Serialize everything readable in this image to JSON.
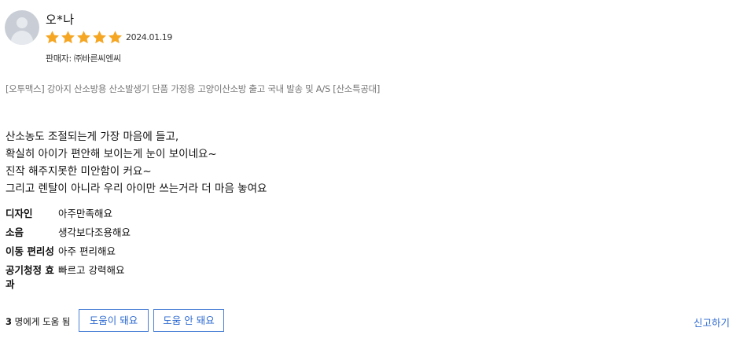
{
  "review": {
    "author": "오*나",
    "rating": 5,
    "rating_max": 5,
    "star_color": "#f5a623",
    "date": "2024.01.19",
    "seller": "판매자: ㈜바른씨엔씨",
    "product": "[오투맥스] 강아지 산소방용 산소발생기 단품 가정용 고양이산소방 출고 국내 발송 및 A/S [산소특공대]",
    "content_lines": [
      "산소농도 조절되는게 가장 마음에 들고,",
      "확실히 아이가 편안해 보이는게 눈이 보이네요~",
      "진작 해주지못한 미안함이 커요~",
      "그리고 렌탈이 아니라 우리 아이만 쓰는거라 더 마음 놓여요"
    ],
    "attributes": [
      {
        "label": "디자인",
        "value": "아주만족해요"
      },
      {
        "label": "소음",
        "value": "생각보다조용해요"
      },
      {
        "label": "이동 편리성",
        "value": "아주 편리해요"
      },
      {
        "label_lines": [
          "공기청정 효",
          "과"
        ],
        "value": "빠르고 강력해요"
      }
    ],
    "helpful_count": "3",
    "helpful_suffix": " 명에게 도움 됨",
    "helpful_yes_label": "도움이 돼요",
    "helpful_no_label": "도움 안 돼요",
    "report_label": "신고하기",
    "accent_color": "#2f6bd1"
  }
}
